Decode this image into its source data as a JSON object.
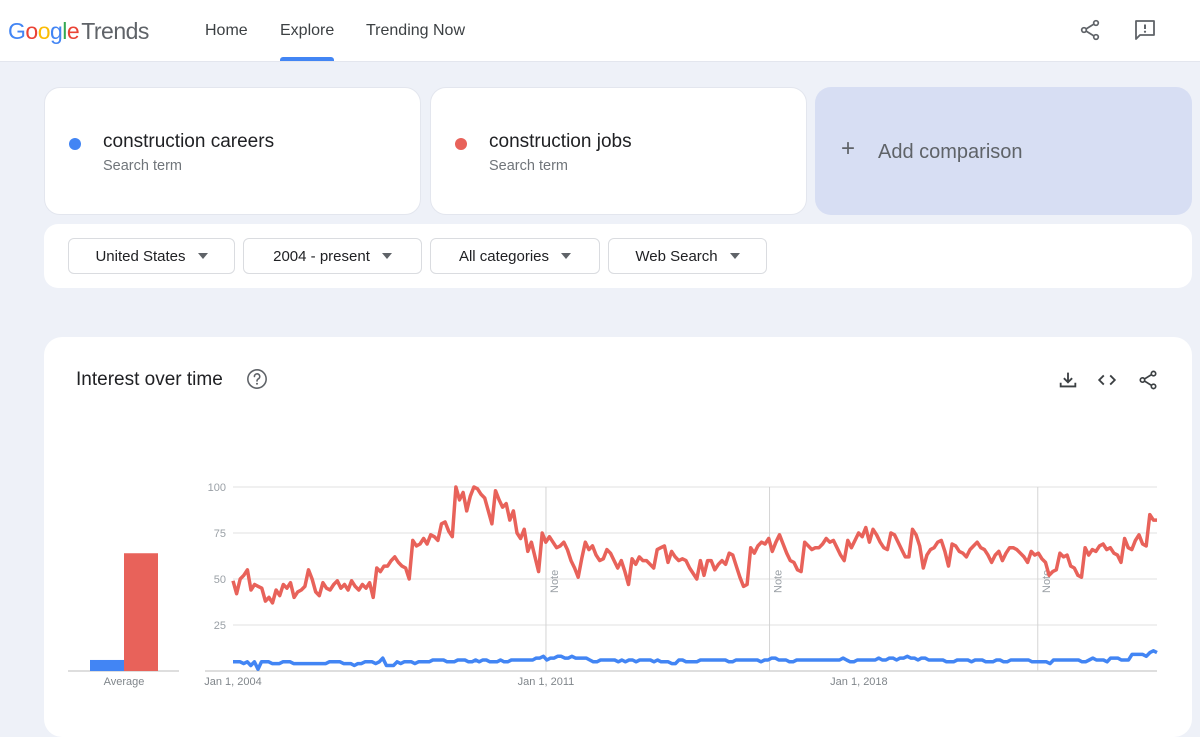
{
  "header": {
    "logo_google": [
      "G",
      "o",
      "o",
      "g",
      "l",
      "e"
    ],
    "logo_product": "Trends",
    "nav": [
      {
        "label": "Home",
        "active": false
      },
      {
        "label": "Explore",
        "active": true
      },
      {
        "label": "Trending Now",
        "active": false
      }
    ],
    "icons": [
      "share-icon",
      "feedback-icon"
    ]
  },
  "search_terms": [
    {
      "name": "construction careers",
      "sub": "Search term",
      "color": "#4285f4"
    },
    {
      "name": "construction jobs",
      "sub": "Search term",
      "color": "#e8625a"
    }
  ],
  "add_comparison": {
    "icon": "+",
    "label": "Add comparison"
  },
  "filters": [
    {
      "label": "United States"
    },
    {
      "label": "2004 - present"
    },
    {
      "label": "All categories"
    },
    {
      "label": "Web Search"
    }
  ],
  "interest_card": {
    "title": "Interest over time",
    "actions": [
      "download-icon",
      "embed-icon",
      "share-icon"
    ]
  },
  "chart_data": {
    "type": "line",
    "title": "Interest over time",
    "xlabel": "",
    "ylabel": "",
    "ylim": [
      0,
      100
    ],
    "yticks": [
      25,
      50,
      75,
      100
    ],
    "xtick_labels": [
      "Jan 1, 2004",
      "Jan 1, 2011",
      "Jan 1, 2018"
    ],
    "x_range": [
      "2004-01",
      "2024-09"
    ],
    "notes": [
      {
        "x": "2011-01",
        "label": "Note"
      },
      {
        "x": "2016-01",
        "label": "Note"
      },
      {
        "x": "2022-01",
        "label": "Note"
      }
    ],
    "grid": true,
    "legend": "none",
    "average": {
      "label": "Average",
      "values": [
        {
          "series": "construction careers",
          "value": 6
        },
        {
          "series": "construction jobs",
          "value": 64
        }
      ]
    },
    "series": [
      {
        "name": "construction jobs",
        "color": "#e8625a",
        "values": [
          49,
          42,
          50,
          52,
          55,
          44,
          47,
          46,
          45,
          38,
          40,
          37,
          44,
          41,
          47,
          45,
          48,
          40,
          43,
          44,
          46,
          55,
          50,
          43,
          41,
          48,
          45,
          44,
          47,
          49,
          45,
          47,
          44,
          49,
          46,
          44,
          47,
          45,
          48,
          40,
          56,
          54,
          57,
          57,
          60,
          62,
          59,
          57,
          56,
          50,
          71,
          68,
          69,
          72,
          69,
          74,
          73,
          71,
          80,
          81,
          76,
          73,
          100,
          93,
          97,
          87,
          95,
          100,
          99,
          96,
          94,
          87,
          80,
          98,
          93,
          89,
          91,
          82,
          87,
          75,
          72,
          77,
          65,
          70,
          62,
          54,
          75,
          70,
          73,
          70,
          67,
          68,
          70,
          66,
          60,
          56,
          51,
          61,
          70,
          66,
          68,
          63,
          60,
          61,
          66,
          64,
          60,
          56,
          60,
          54,
          47,
          61,
          58,
          62,
          60,
          60,
          58,
          56,
          66,
          67,
          68,
          59,
          65,
          62,
          60,
          61,
          60,
          56,
          53,
          50,
          60,
          52,
          60,
          60,
          55,
          58,
          60,
          58,
          64,
          63,
          57,
          51,
          46,
          47,
          67,
          64,
          68,
          70,
          69,
          72,
          65,
          70,
          74,
          69,
          64,
          60,
          59,
          55,
          54,
          70,
          68,
          66,
          67,
          67,
          69,
          72,
          70,
          71,
          67,
          63,
          60,
          71,
          67,
          71,
          75,
          73,
          78,
          70,
          77,
          74,
          70,
          67,
          66,
          75,
          74,
          70,
          66,
          62,
          62,
          77,
          74,
          68,
          56,
          63,
          66,
          67,
          70,
          71,
          65,
          57,
          69,
          68,
          65,
          64,
          62,
          66,
          68,
          70,
          67,
          66,
          63,
          59,
          63,
          65,
          60,
          64,
          67,
          67,
          66,
          64,
          62,
          59,
          65,
          63,
          64,
          61,
          59,
          52,
          54,
          55,
          64,
          62,
          63,
          57,
          56,
          52,
          51,
          67,
          63,
          66,
          65,
          68,
          69,
          66,
          67,
          64,
          63,
          59,
          72,
          67,
          66,
          71,
          74,
          69,
          68,
          85,
          82,
          82
        ]
      },
      {
        "name": "construction careers",
        "color": "#4285f4",
        "values": [
          5,
          5,
          5,
          4,
          5,
          3,
          5,
          1,
          5,
          5,
          5,
          4,
          4,
          4,
          5,
          5,
          5,
          4,
          4,
          4,
          4,
          4,
          4,
          4,
          4,
          4,
          4,
          5,
          5,
          5,
          5,
          4,
          4,
          4,
          3,
          4,
          4,
          5,
          5,
          5,
          4,
          5,
          7,
          3,
          3,
          3,
          5,
          4,
          5,
          5,
          5,
          4,
          5,
          5,
          5,
          5,
          6,
          6,
          6,
          6,
          5,
          5,
          5,
          6,
          6,
          6,
          5,
          5,
          6,
          5,
          6,
          6,
          5,
          5,
          5,
          6,
          5,
          5,
          6,
          6,
          6,
          6,
          6,
          6,
          6,
          7,
          7,
          8,
          6,
          7,
          7,
          8,
          8,
          7,
          7,
          8,
          7,
          7,
          7,
          7,
          6,
          5,
          5,
          6,
          6,
          6,
          6,
          6,
          5,
          6,
          5,
          6,
          6,
          5,
          6,
          6,
          6,
          6,
          5,
          6,
          5,
          5,
          5,
          4,
          4,
          6,
          6,
          5,
          5,
          5,
          5,
          6,
          6,
          6,
          6,
          6,
          6,
          6,
          6,
          5,
          5,
          6,
          6,
          6,
          6,
          6,
          6,
          6,
          5,
          6,
          6,
          7,
          7,
          6,
          6,
          6,
          5,
          5,
          6,
          6,
          6,
          6,
          6,
          6,
          6,
          6,
          6,
          6,
          6,
          6,
          6,
          7,
          6,
          5,
          5,
          6,
          6,
          6,
          6,
          6,
          6,
          7,
          6,
          6,
          7,
          7,
          6,
          7,
          7,
          8,
          7,
          7,
          6,
          7,
          7,
          6,
          6,
          6,
          6,
          6,
          5,
          5,
          5,
          6,
          6,
          6,
          6,
          5,
          6,
          6,
          6,
          5,
          5,
          5,
          6,
          6,
          5,
          5,
          6,
          6,
          6,
          6,
          6,
          6,
          5,
          5,
          5,
          5,
          5,
          4,
          6,
          6,
          6,
          6,
          6,
          6,
          6,
          6,
          5,
          5,
          6,
          7,
          6,
          6,
          6,
          5,
          7,
          7,
          7,
          6,
          6,
          6,
          9,
          9,
          9,
          9,
          8,
          10,
          11,
          10
        ]
      }
    ]
  }
}
